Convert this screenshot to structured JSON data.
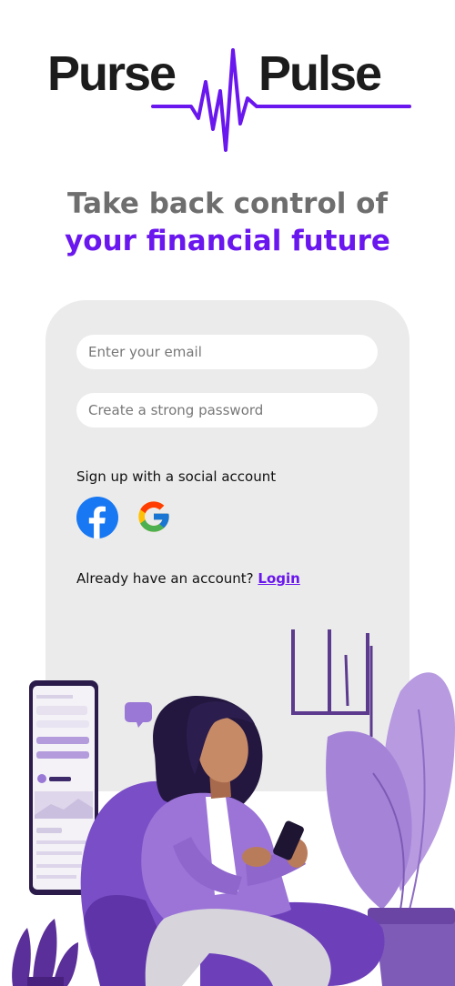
{
  "brand": {
    "word_left": "Purse",
    "word_right": "Pulse",
    "accent_color": "#6a16ee"
  },
  "tagline": {
    "line1": "Take back control of",
    "line2": "your financial future"
  },
  "form": {
    "email_placeholder": "Enter your email",
    "password_placeholder": "Create a strong password"
  },
  "social": {
    "label": "Sign up with a social account",
    "providers": [
      {
        "name": "facebook",
        "icon": "facebook-icon",
        "color": "#1877f2"
      },
      {
        "name": "google",
        "icon": "google-icon"
      }
    ]
  },
  "login": {
    "prompt": "Already have an account?",
    "link_label": "Login"
  },
  "colors": {
    "card_bg": "#ebebeb",
    "illustration_purple": "#9a78d6"
  }
}
